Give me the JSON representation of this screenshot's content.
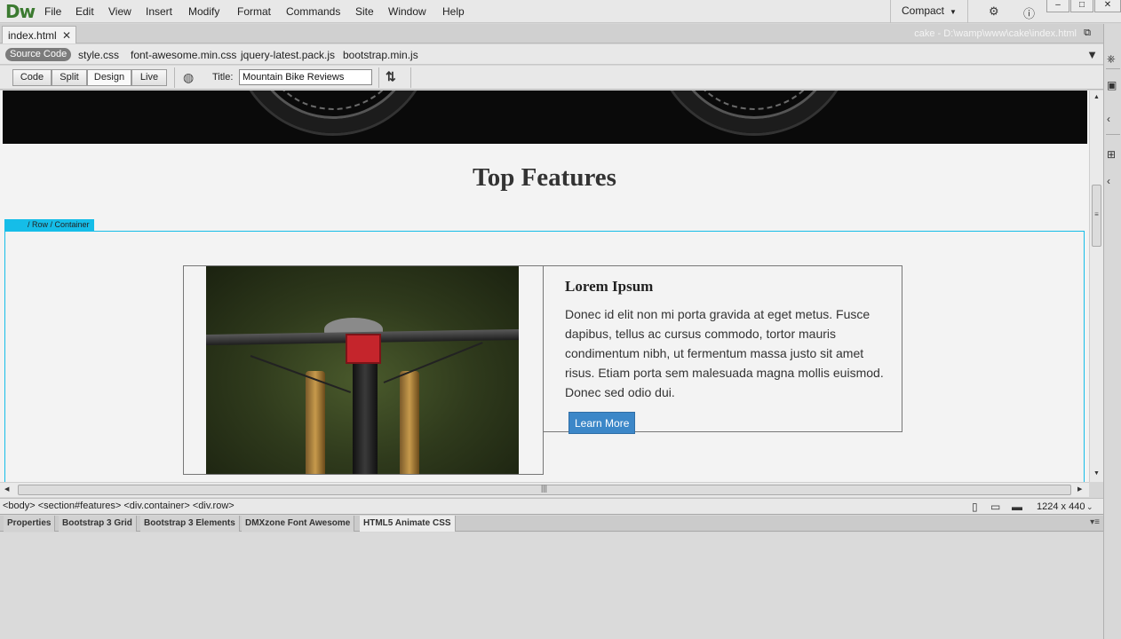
{
  "app": {
    "logo": "Dw",
    "menus": [
      "File",
      "Edit",
      "View",
      "Insert",
      "Modify",
      "Format",
      "Commands",
      "Site",
      "Window",
      "Help"
    ],
    "workspace": "Compact"
  },
  "document": {
    "tab_label": "index.html",
    "path": "cake - D:\\wamp\\www\\cake\\index.html",
    "related_files": [
      "Source Code",
      "style.css",
      "font-awesome.min.css",
      "jquery-latest.pack.js",
      "bootstrap.min.js"
    ]
  },
  "toolbar": {
    "views": [
      "Code",
      "Split",
      "Design",
      "Live"
    ],
    "active_view": "Design",
    "title_label": "Title:",
    "title_value": "Mountain Bike Reviews"
  },
  "page": {
    "section_title": "Top Features",
    "container_tag": "/ Row / Container",
    "card_title": "Lorem Ipsum",
    "card_body": "Donec id elit non mi porta gravida at eget metus. Fusce dapibus, tellus ac cursus commodo, tortor mauris condimentum nibh, ut fermentum massa justo sit amet risus. Etiam porta sem malesuada magna mollis euismod. Donec sed odio dui.",
    "button_label": "Learn More"
  },
  "status": {
    "tag_path": "<body> <section#features> <div.container> <div.row>",
    "window_size": "1224 x 440"
  },
  "panels": {
    "tabs": [
      "Properties",
      "Bootstrap 3 Grid",
      "Bootstrap 3 Elements",
      "DMXzone Font Awesome",
      "HTML5 Animate CSS"
    ],
    "active": "HTML5 Animate CSS"
  },
  "colors": {
    "selection": "#15bde8",
    "button": "#3c87c8",
    "logo": "#3b7a30"
  }
}
